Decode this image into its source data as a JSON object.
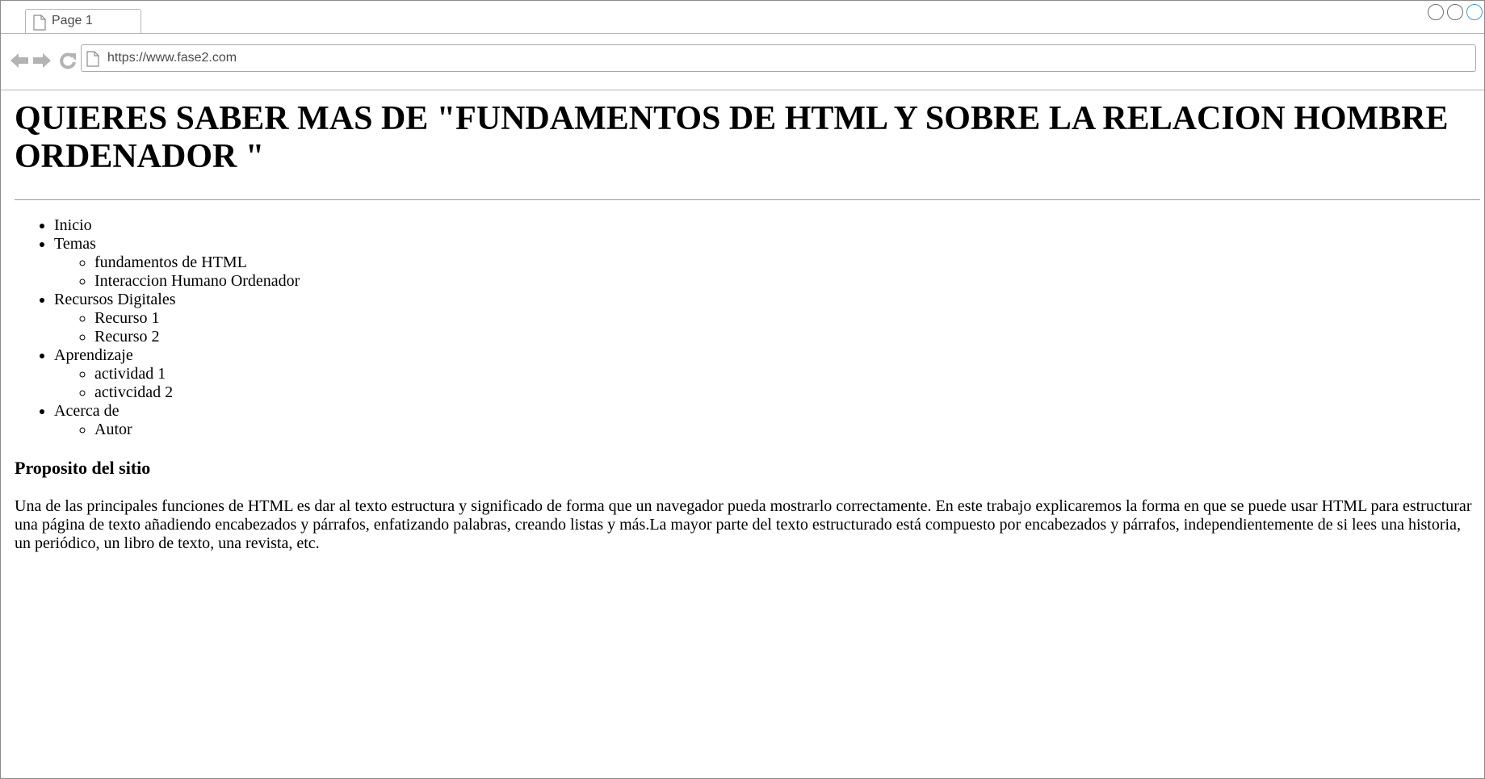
{
  "browser": {
    "tab_title": "Page 1",
    "url": "https://www.fase2.com",
    "accent_color": "#3aa0d9",
    "icons": [
      "page-icon",
      "back-arrow-icon",
      "forward-arrow-icon",
      "reload-icon"
    ]
  },
  "page": {
    "title": "QUIERES SABER MAS DE \"FUNDAMENTOS DE HTML Y SOBRE LA RELACION HOMBRE ORDENADOR \"",
    "nav": [
      {
        "label": "Inicio",
        "children": []
      },
      {
        "label": "Temas",
        "children": [
          "fundamentos de HTML",
          "Interaccion Humano Ordenador"
        ]
      },
      {
        "label": "Recursos Digitales",
        "children": [
          "Recurso 1",
          "Recurso 2"
        ]
      },
      {
        "label": "Aprendizaje",
        "children": [
          "actividad 1",
          "activcidad 2"
        ]
      },
      {
        "label": "Acerca de",
        "children": [
          "Autor"
        ]
      }
    ],
    "section_title": "Proposito del sitio",
    "body_text": "Una de las principales funciones de HTML es dar al texto estructura y significado de forma que un navegador pueda mostrarlo correctamente. En este trabajo explicaremos la forma en que se puede usar HTML para estructurar una página de texto añadiendo encabezados y párrafos, enfatizando palabras, creando listas y más.La mayor parte del texto estructurado está compuesto por encabezados y párrafos, independientemente de si lees una historia, un periódico, un libro de texto, una revista, etc."
  }
}
